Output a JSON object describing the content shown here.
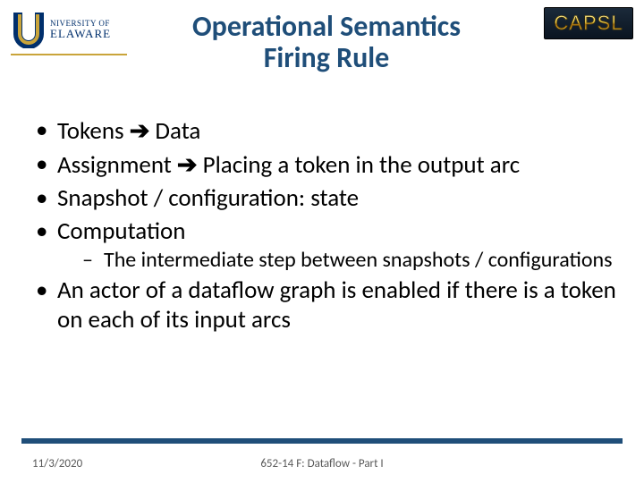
{
  "logos": {
    "left_line1": "NIVERSITY OF",
    "left_line2": "ELAWARE",
    "right": "CAPSL"
  },
  "title": {
    "line1": "Operational Semantics",
    "line2": "Firing Rule"
  },
  "bullets": {
    "b1_left": "Tokens ",
    "b1_arrow": "➔",
    "b1_right": " Data",
    "b2_left": "Assignment ",
    "b2_arrow": "➔",
    "b2_right": " Placing a token in the output arc",
    "b3": "Snapshot / configuration: state",
    "b4": "Computation",
    "b4_sub": "The intermediate step between snapshots / configurations",
    "b5": "An actor of a dataflow graph is enabled if there is a token on each of its input arcs"
  },
  "footer": {
    "date": "11/3/2020",
    "course": "652-14 F: Dataflow - Part I"
  }
}
